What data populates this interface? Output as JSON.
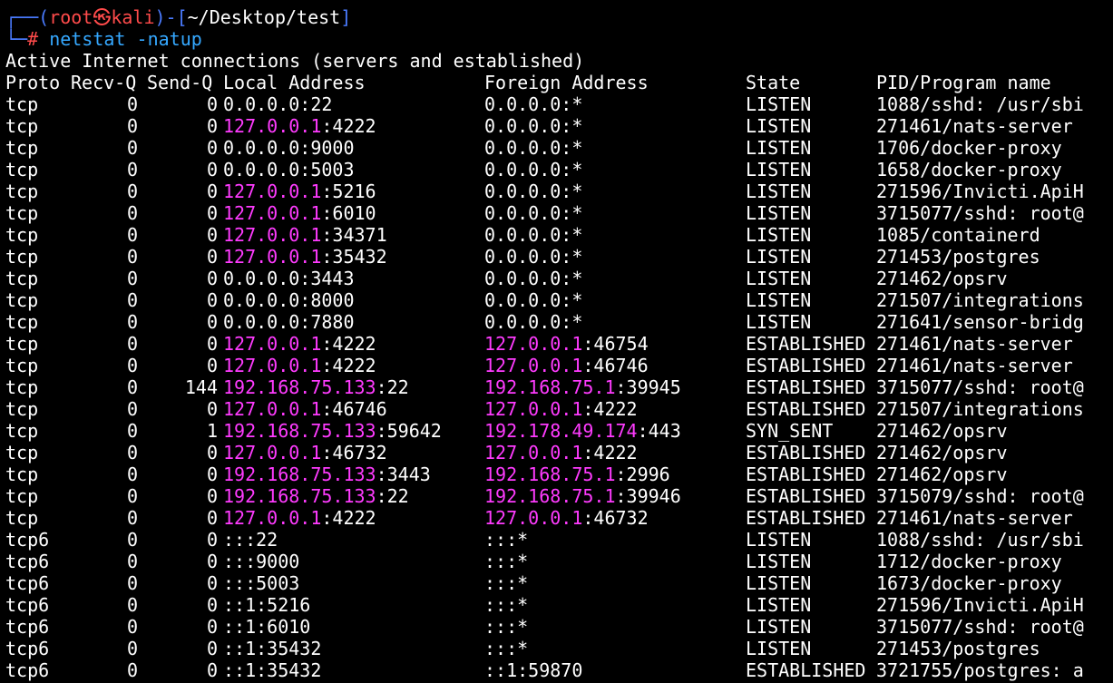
{
  "prompt": {
    "top_left": "┌──(",
    "user": "root㉿",
    "host": "kali",
    "bracket_mid": ")-[",
    "cwd": "~/Desktop/test",
    "bracket_end": "]",
    "bottom_left": "└─",
    "hash": "#",
    "command": "netstat",
    "args": " -natup"
  },
  "title_line": "Active Internet connections (servers and established)",
  "headers": {
    "proto": "Proto",
    "recvq": "Recv-Q",
    "sendq": "Send-Q",
    "local": "Local Address",
    "foreign": "Foreign Address",
    "state": "State",
    "pid": "PID/Program name"
  },
  "rows": [
    {
      "proto": "tcp",
      "recvq": "0",
      "sendq": "0",
      "local_ip": "0.0.0.0",
      "local_port": ":22",
      "local_hl": false,
      "foreign_ip": "0.0.0.0",
      "foreign_port": ":*",
      "foreign_hl": false,
      "state": "LISTEN",
      "pid": "1088/sshd: /usr/sbi"
    },
    {
      "proto": "tcp",
      "recvq": "0",
      "sendq": "0",
      "local_ip": "127.0.0.1",
      "local_port": ":4222",
      "local_hl": true,
      "foreign_ip": "0.0.0.0",
      "foreign_port": ":*",
      "foreign_hl": false,
      "state": "LISTEN",
      "pid": "271461/nats-server"
    },
    {
      "proto": "tcp",
      "recvq": "0",
      "sendq": "0",
      "local_ip": "0.0.0.0",
      "local_port": ":9000",
      "local_hl": false,
      "foreign_ip": "0.0.0.0",
      "foreign_port": ":*",
      "foreign_hl": false,
      "state": "LISTEN",
      "pid": "1706/docker-proxy"
    },
    {
      "proto": "tcp",
      "recvq": "0",
      "sendq": "0",
      "local_ip": "0.0.0.0",
      "local_port": ":5003",
      "local_hl": false,
      "foreign_ip": "0.0.0.0",
      "foreign_port": ":*",
      "foreign_hl": false,
      "state": "LISTEN",
      "pid": "1658/docker-proxy"
    },
    {
      "proto": "tcp",
      "recvq": "0",
      "sendq": "0",
      "local_ip": "127.0.0.1",
      "local_port": ":5216",
      "local_hl": true,
      "foreign_ip": "0.0.0.0",
      "foreign_port": ":*",
      "foreign_hl": false,
      "state": "LISTEN",
      "pid": "271596/Invicti.ApiH"
    },
    {
      "proto": "tcp",
      "recvq": "0",
      "sendq": "0",
      "local_ip": "127.0.0.1",
      "local_port": ":6010",
      "local_hl": true,
      "foreign_ip": "0.0.0.0",
      "foreign_port": ":*",
      "foreign_hl": false,
      "state": "LISTEN",
      "pid": "3715077/sshd: root@"
    },
    {
      "proto": "tcp",
      "recvq": "0",
      "sendq": "0",
      "local_ip": "127.0.0.1",
      "local_port": ":34371",
      "local_hl": true,
      "foreign_ip": "0.0.0.0",
      "foreign_port": ":*",
      "foreign_hl": false,
      "state": "LISTEN",
      "pid": "1085/containerd"
    },
    {
      "proto": "tcp",
      "recvq": "0",
      "sendq": "0",
      "local_ip": "127.0.0.1",
      "local_port": ":35432",
      "local_hl": true,
      "foreign_ip": "0.0.0.0",
      "foreign_port": ":*",
      "foreign_hl": false,
      "state": "LISTEN",
      "pid": "271453/postgres"
    },
    {
      "proto": "tcp",
      "recvq": "0",
      "sendq": "0",
      "local_ip": "0.0.0.0",
      "local_port": ":3443",
      "local_hl": false,
      "foreign_ip": "0.0.0.0",
      "foreign_port": ":*",
      "foreign_hl": false,
      "state": "LISTEN",
      "pid": "271462/opsrv"
    },
    {
      "proto": "tcp",
      "recvq": "0",
      "sendq": "0",
      "local_ip": "0.0.0.0",
      "local_port": ":8000",
      "local_hl": false,
      "foreign_ip": "0.0.0.0",
      "foreign_port": ":*",
      "foreign_hl": false,
      "state": "LISTEN",
      "pid": "271507/integrations"
    },
    {
      "proto": "tcp",
      "recvq": "0",
      "sendq": "0",
      "local_ip": "0.0.0.0",
      "local_port": ":7880",
      "local_hl": false,
      "foreign_ip": "0.0.0.0",
      "foreign_port": ":*",
      "foreign_hl": false,
      "state": "LISTEN",
      "pid": "271641/sensor-bridg"
    },
    {
      "proto": "tcp",
      "recvq": "0",
      "sendq": "0",
      "local_ip": "127.0.0.1",
      "local_port": ":4222",
      "local_hl": true,
      "foreign_ip": "127.0.0.1",
      "foreign_port": ":46754",
      "foreign_hl": true,
      "state": "ESTABLISHED",
      "pid": "271461/nats-server"
    },
    {
      "proto": "tcp",
      "recvq": "0",
      "sendq": "0",
      "local_ip": "127.0.0.1",
      "local_port": ":4222",
      "local_hl": true,
      "foreign_ip": "127.0.0.1",
      "foreign_port": ":46746",
      "foreign_hl": true,
      "state": "ESTABLISHED",
      "pid": "271461/nats-server"
    },
    {
      "proto": "tcp",
      "recvq": "0",
      "sendq": "144",
      "local_ip": "192.168.75.133",
      "local_port": ":22",
      "local_hl": true,
      "foreign_ip": "192.168.75.1",
      "foreign_port": ":39945",
      "foreign_hl": true,
      "state": "ESTABLISHED",
      "pid": "3715077/sshd: root@"
    },
    {
      "proto": "tcp",
      "recvq": "0",
      "sendq": "0",
      "local_ip": "127.0.0.1",
      "local_port": ":46746",
      "local_hl": true,
      "foreign_ip": "127.0.0.1",
      "foreign_port": ":4222",
      "foreign_hl": true,
      "state": "ESTABLISHED",
      "pid": "271507/integrations"
    },
    {
      "proto": "tcp",
      "recvq": "0",
      "sendq": "1",
      "local_ip": "192.168.75.133",
      "local_port": ":59642",
      "local_hl": true,
      "foreign_ip": "192.178.49.174",
      "foreign_port": ":443",
      "foreign_hl": true,
      "state": "SYN_SENT",
      "pid": "271462/opsrv"
    },
    {
      "proto": "tcp",
      "recvq": "0",
      "sendq": "0",
      "local_ip": "127.0.0.1",
      "local_port": ":46732",
      "local_hl": true,
      "foreign_ip": "127.0.0.1",
      "foreign_port": ":4222",
      "foreign_hl": true,
      "state": "ESTABLISHED",
      "pid": "271462/opsrv"
    },
    {
      "proto": "tcp",
      "recvq": "0",
      "sendq": "0",
      "local_ip": "192.168.75.133",
      "local_port": ":3443",
      "local_hl": true,
      "foreign_ip": "192.168.75.1",
      "foreign_port": ":2996",
      "foreign_hl": true,
      "state": "ESTABLISHED",
      "pid": "271462/opsrv"
    },
    {
      "proto": "tcp",
      "recvq": "0",
      "sendq": "0",
      "local_ip": "192.168.75.133",
      "local_port": ":22",
      "local_hl": true,
      "foreign_ip": "192.168.75.1",
      "foreign_port": ":39946",
      "foreign_hl": true,
      "state": "ESTABLISHED",
      "pid": "3715079/sshd: root@"
    },
    {
      "proto": "tcp",
      "recvq": "0",
      "sendq": "0",
      "local_ip": "127.0.0.1",
      "local_port": ":4222",
      "local_hl": true,
      "foreign_ip": "127.0.0.1",
      "foreign_port": ":46732",
      "foreign_hl": true,
      "state": "ESTABLISHED",
      "pid": "271461/nats-server"
    },
    {
      "proto": "tcp6",
      "recvq": "0",
      "sendq": "0",
      "local_ip": "",
      "local_port": ":::22",
      "local_hl": false,
      "foreign_ip": "",
      "foreign_port": ":::*",
      "foreign_hl": false,
      "state": "LISTEN",
      "pid": "1088/sshd: /usr/sbi"
    },
    {
      "proto": "tcp6",
      "recvq": "0",
      "sendq": "0",
      "local_ip": "",
      "local_port": ":::9000",
      "local_hl": false,
      "foreign_ip": "",
      "foreign_port": ":::*",
      "foreign_hl": false,
      "state": "LISTEN",
      "pid": "1712/docker-proxy"
    },
    {
      "proto": "tcp6",
      "recvq": "0",
      "sendq": "0",
      "local_ip": "",
      "local_port": ":::5003",
      "local_hl": false,
      "foreign_ip": "",
      "foreign_port": ":::*",
      "foreign_hl": false,
      "state": "LISTEN",
      "pid": "1673/docker-proxy"
    },
    {
      "proto": "tcp6",
      "recvq": "0",
      "sendq": "0",
      "local_ip": "",
      "local_port": "::1:5216",
      "local_hl": false,
      "foreign_ip": "",
      "foreign_port": ":::*",
      "foreign_hl": false,
      "state": "LISTEN",
      "pid": "271596/Invicti.ApiH"
    },
    {
      "proto": "tcp6",
      "recvq": "0",
      "sendq": "0",
      "local_ip": "",
      "local_port": "::1:6010",
      "local_hl": false,
      "foreign_ip": "",
      "foreign_port": ":::*",
      "foreign_hl": false,
      "state": "LISTEN",
      "pid": "3715077/sshd: root@"
    },
    {
      "proto": "tcp6",
      "recvq": "0",
      "sendq": "0",
      "local_ip": "",
      "local_port": "::1:35432",
      "local_hl": false,
      "foreign_ip": "",
      "foreign_port": ":::*",
      "foreign_hl": false,
      "state": "LISTEN",
      "pid": "271453/postgres"
    },
    {
      "proto": "tcp6",
      "recvq": "0",
      "sendq": "0",
      "local_ip": "",
      "local_port": "::1:35432",
      "local_hl": false,
      "foreign_ip": "",
      "foreign_port": "::1:59870",
      "foreign_hl": false,
      "state": "ESTABLISHED",
      "pid": "3721755/postgres: a"
    }
  ],
  "colors": {
    "background": "#000000",
    "text": "#ffffff",
    "prompt_frame": "#4a7bff",
    "prompt_user": "#ff4b4b",
    "command": "#35a8ff",
    "ip_highlight": "#ff3bff"
  }
}
